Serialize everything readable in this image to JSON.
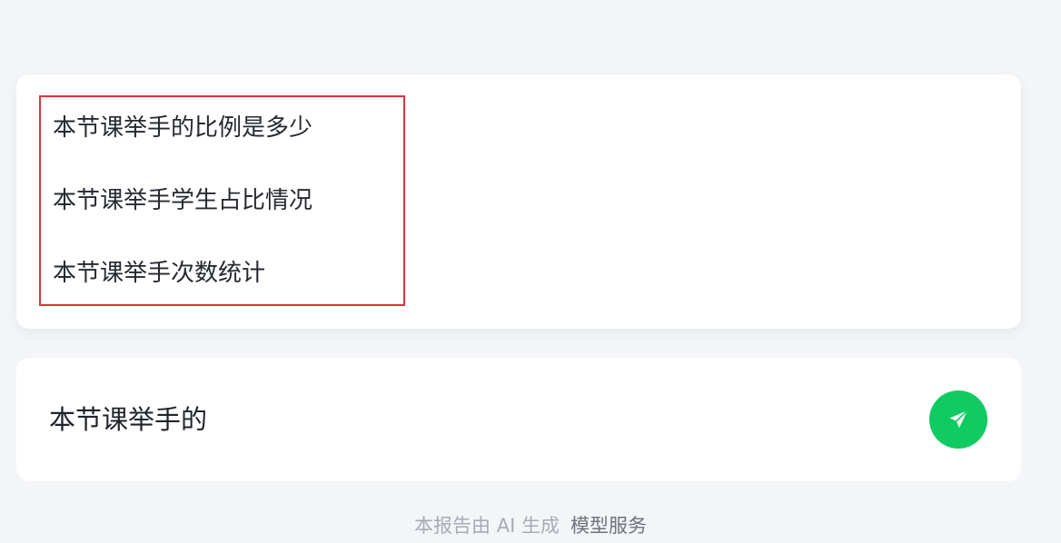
{
  "suggestions": {
    "items": [
      "本节课举手的比例是多少",
      "本节课举手学生占比情况",
      "本节课举手次数统计"
    ]
  },
  "input": {
    "value": "本节课举手的"
  },
  "send_button": {
    "icon": "paper-plane-icon",
    "color": "#0FCB61"
  },
  "footer": {
    "note": "本报告由 AI 生成",
    "link": "模型服务"
  },
  "colors": {
    "background": "#F3F5F8",
    "highlight": "#E0313B"
  }
}
